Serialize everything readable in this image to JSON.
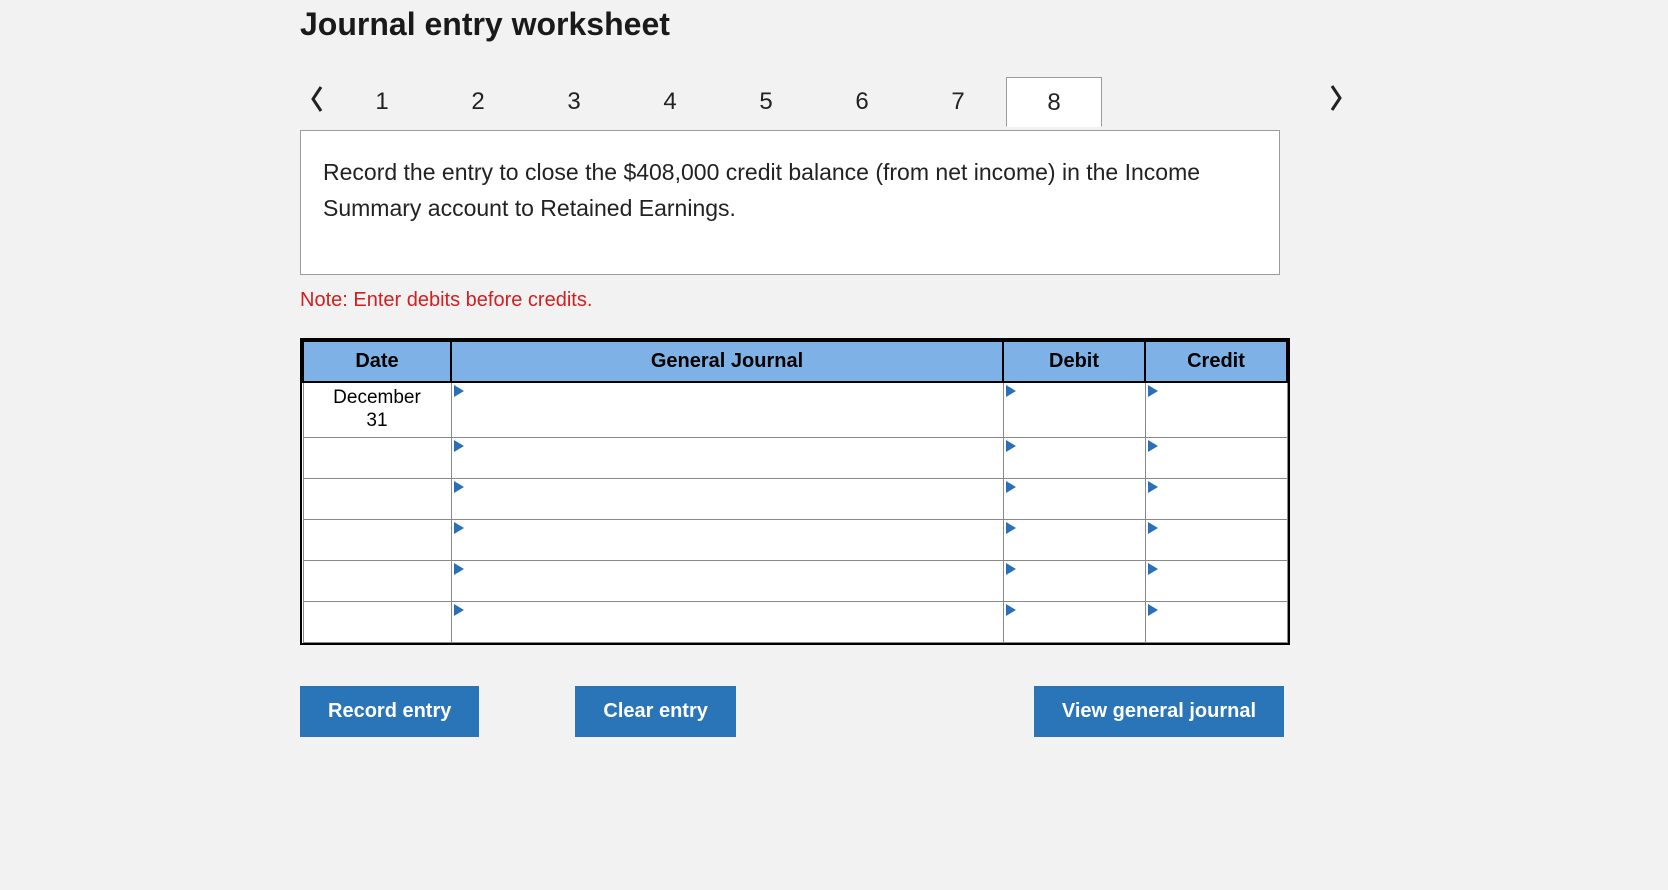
{
  "heading": "Journal entry worksheet",
  "tabs": [
    "1",
    "2",
    "3",
    "4",
    "5",
    "6",
    "7",
    "8"
  ],
  "active_tab_index": 7,
  "instruction": "Record the entry to close the $408,000 credit balance (from net income) in the Income Summary account to Retained Earnings.",
  "note": "Note: Enter debits before credits.",
  "table": {
    "headers": {
      "date": "Date",
      "general": "General Journal",
      "debit": "Debit",
      "credit": "Credit"
    },
    "rows": [
      {
        "date": "December 31",
        "general": "",
        "debit": "",
        "credit": ""
      },
      {
        "date": "",
        "general": "",
        "debit": "",
        "credit": ""
      },
      {
        "date": "",
        "general": "",
        "debit": "",
        "credit": ""
      },
      {
        "date": "",
        "general": "",
        "debit": "",
        "credit": ""
      },
      {
        "date": "",
        "general": "",
        "debit": "",
        "credit": ""
      },
      {
        "date": "",
        "general": "",
        "debit": "",
        "credit": ""
      }
    ]
  },
  "buttons": {
    "record": "Record entry",
    "clear": "Clear entry",
    "view": "View general journal"
  }
}
